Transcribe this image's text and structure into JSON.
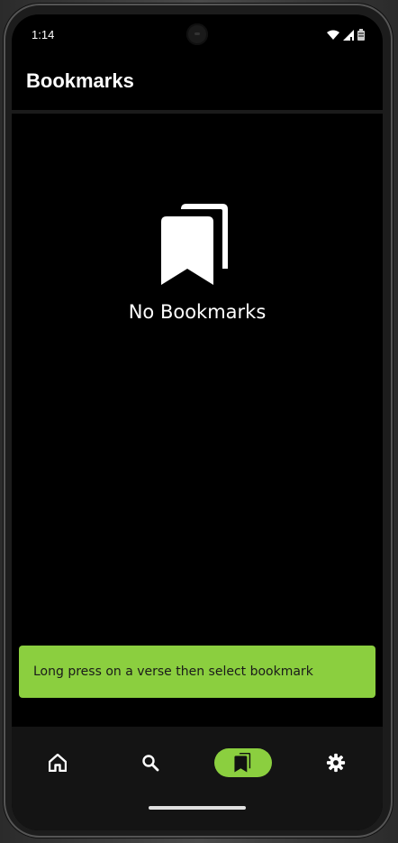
{
  "status_bar": {
    "time": "1:14",
    "icons": [
      "wifi-icon",
      "signal-icon",
      "battery-icon"
    ]
  },
  "header": {
    "title": "Bookmarks"
  },
  "empty_state": {
    "icon": "bookmarks-icon",
    "message": "No Bookmarks"
  },
  "snackbar": {
    "message": "Long press on a verse then select bookmark"
  },
  "bottom_nav": {
    "items": [
      {
        "icon": "home-icon",
        "active": false
      },
      {
        "icon": "search-icon",
        "active": false
      },
      {
        "icon": "bookmarks-icon",
        "active": true
      },
      {
        "icon": "gear-icon",
        "active": false
      }
    ]
  },
  "colors": {
    "accent": "#8bcf3f",
    "background": "#000000",
    "nav_background": "#141414"
  }
}
